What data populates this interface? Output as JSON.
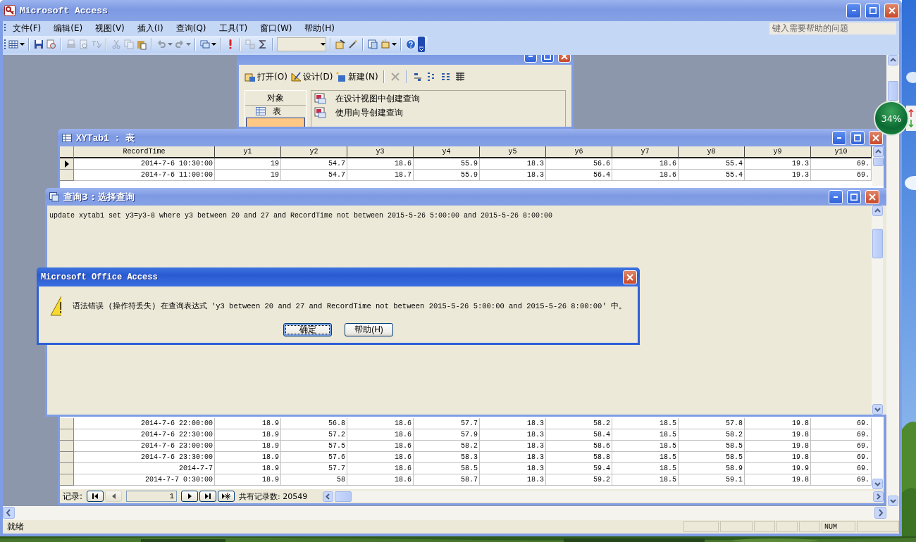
{
  "main_window": {
    "title": "Microsoft Access"
  },
  "menu": [
    {
      "label": "文件(F)"
    },
    {
      "label": "编辑(E)"
    },
    {
      "label": "视图(V)"
    },
    {
      "label": "插入(I)"
    },
    {
      "label": "查询(Q)"
    },
    {
      "label": "工具(T)"
    },
    {
      "label": "窗口(W)"
    },
    {
      "label": "帮助(H)"
    }
  ],
  "help_box": {
    "placeholder": "键入需要帮助的问题"
  },
  "toolbar": [
    {
      "kind": "split",
      "disabled": false
    },
    {
      "kind": "separator"
    },
    {
      "kind": "button",
      "disabled": false
    },
    {
      "kind": "button",
      "disabled": false
    },
    {
      "kind": "separator"
    },
    {
      "kind": "button",
      "disabled": true
    },
    {
      "kind": "button",
      "disabled": true
    },
    {
      "kind": "button",
      "disabled": true
    },
    {
      "kind": "separator"
    },
    {
      "kind": "button",
      "disabled": true
    },
    {
      "kind": "button",
      "disabled": true
    },
    {
      "kind": "button",
      "disabled": false
    },
    {
      "kind": "separator"
    },
    {
      "kind": "split",
      "disabled": true
    },
    {
      "kind": "split",
      "disabled": true
    },
    {
      "kind": "separator"
    },
    {
      "kind": "split",
      "disabled": false
    },
    {
      "kind": "separator"
    },
    {
      "kind": "button",
      "disabled": false
    },
    {
      "kind": "separator"
    },
    {
      "kind": "button",
      "disabled": true
    },
    {
      "kind": "button",
      "disabled": false
    },
    {
      "kind": "separator"
    },
    {
      "kind": "combo",
      "disabled": true
    },
    {
      "kind": "separator"
    },
    {
      "kind": "button",
      "disabled": false
    },
    {
      "kind": "button",
      "disabled": false
    },
    {
      "kind": "separator"
    },
    {
      "kind": "button",
      "disabled": false
    },
    {
      "kind": "split",
      "disabled": false
    },
    {
      "kind": "separator"
    },
    {
      "kind": "button",
      "disabled": false
    }
  ],
  "db_window": {
    "toolbar": [
      {
        "kind": "text",
        "label": "打开(O)",
        "disabled": false
      },
      {
        "kind": "text",
        "label": "设计(D)",
        "disabled": false
      },
      {
        "kind": "text",
        "label": "新建(N)",
        "disabled": false
      },
      {
        "kind": "separator"
      },
      {
        "kind": "icon",
        "disabled": true
      },
      {
        "kind": "separator"
      },
      {
        "kind": "icon",
        "disabled": false
      },
      {
        "kind": "icon",
        "disabled": false
      },
      {
        "kind": "icon",
        "disabled": false
      },
      {
        "kind": "icon",
        "disabled": false
      }
    ],
    "objects_header": "对象",
    "objects": [
      {
        "label": "表",
        "selected": false
      },
      {
        "selected": true
      }
    ],
    "items": [
      "在设计视图中创建查询",
      "使用向导创建查询"
    ]
  },
  "table_window": {
    "title": "XYTab1 : 表",
    "columns": [
      "RecordTime",
      "y1",
      "y2",
      "y3",
      "y4",
      "y5",
      "y6",
      "y7",
      "y8",
      "y9",
      "y10"
    ],
    "rows_top": [
      {
        "selected": true,
        "cells": [
          "2014-7-6 10:30:00",
          "19",
          "54.7",
          "18.6",
          "55.9",
          "18.3",
          "56.6",
          "18.6",
          "55.4",
          "19.3",
          "69."
        ]
      },
      {
        "selected": false,
        "cells": [
          "2014-7-6 11:00:00",
          "19",
          "54.7",
          "18.7",
          "55.9",
          "18.3",
          "56.4",
          "18.6",
          "55.4",
          "19.3",
          "69."
        ]
      }
    ],
    "rows_bottom": [
      {
        "selected": false,
        "cells": [
          "2014-7-6 22:00:00",
          "18.9",
          "56.8",
          "18.6",
          "57.7",
          "18.3",
          "58.2",
          "18.5",
          "57.8",
          "19.8",
          "69."
        ]
      },
      {
        "selected": false,
        "cells": [
          "2014-7-6 22:30:00",
          "18.9",
          "57.2",
          "18.6",
          "57.9",
          "18.3",
          "58.4",
          "18.5",
          "58.2",
          "19.8",
          "69."
        ]
      },
      {
        "selected": false,
        "cells": [
          "2014-7-6 23:00:00",
          "18.9",
          "57.5",
          "18.6",
          "58.2",
          "18.3",
          "58.6",
          "18.5",
          "58.5",
          "19.8",
          "69."
        ]
      },
      {
        "selected": false,
        "cells": [
          "2014-7-6 23:30:00",
          "18.9",
          "57.6",
          "18.6",
          "58.3",
          "18.3",
          "58.8",
          "18.5",
          "58.5",
          "19.8",
          "69."
        ]
      },
      {
        "selected": false,
        "cells": [
          "2014-7-7",
          "18.9",
          "57.7",
          "18.6",
          "58.5",
          "18.3",
          "59.4",
          "18.5",
          "58.9",
          "19.9",
          "69."
        ]
      },
      {
        "selected": false,
        "cells": [
          "2014-7-7 0:30:00",
          "18.9",
          "58",
          "18.6",
          "58.7",
          "18.3",
          "59.2",
          "18.5",
          "59.1",
          "19.8",
          "69."
        ]
      }
    ],
    "navigation": {
      "label": "记录:",
      "record": "1",
      "count": "共有记录数: 20549",
      "buttons": [
        {
          "disabled": false
        },
        {
          "disabled": true
        },
        {
          "disabled": false
        },
        {
          "disabled": false
        },
        {
          "disabled": false
        }
      ]
    }
  },
  "query_window": {
    "title": "查询3 : 选择查询",
    "sql": "update xytab1 set y3=y3-8 where y3 between 20 and 27 and RecordTime not between 2015-5-26 5:00:00 and 2015-5-26 8:00:00"
  },
  "dialog": {
    "title": "Microsoft Office Access",
    "message": "语法错误 (操作符丢失) 在查询表达式 'y3 between 20 and 27 and RecordTime not between 2015-5-26 5:00:00 and 2015-5-26 8:00:00' 中。",
    "buttons": [
      {
        "label": "确定",
        "focused": true
      },
      {
        "label": "帮助(H)",
        "focused": false
      }
    ]
  },
  "status_bar": {
    "text": "就绪",
    "indicators": [
      "NUM"
    ]
  },
  "speed_ball": {
    "text": "34%"
  }
}
